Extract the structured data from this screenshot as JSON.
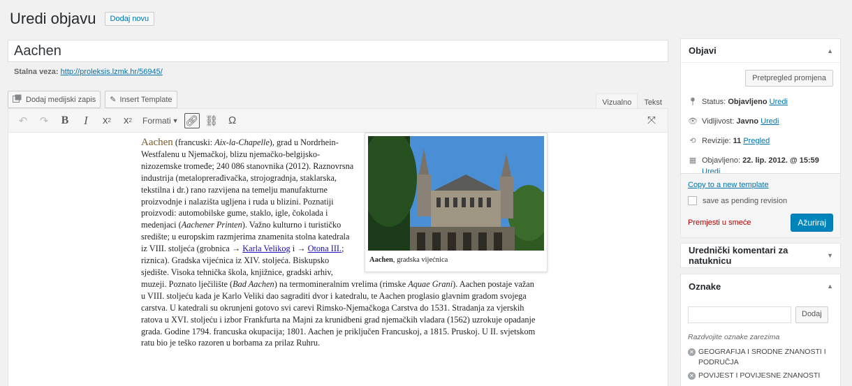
{
  "header": {
    "title": "Uredi objavu",
    "add_new": "Dodaj novu"
  },
  "post": {
    "title": "Aachen",
    "permalink_label": "Stalna veza:",
    "permalink_url": "http://proleksis.lzmk.hr/56945/"
  },
  "media": {
    "add_media": "Dodaj medijski zapis",
    "insert_template": "Insert Template"
  },
  "editor_tabs": {
    "visual": "Vizualno",
    "text": "Tekst"
  },
  "toolbar": {
    "format": "Formati"
  },
  "article": {
    "head": "Aachen",
    "p1": " (francuski: ",
    "p1_italic": "Aix-la-Chapelle",
    "p2": "), grad u Nordrhein-Westfalenu u Njemačkoj, blizu njemačko-belgijsko-nizozemske tromeđe; 240 086 stanovnika (2012). Raznovrsna industrija (metaloprerađivačka, strojogradnja, staklarska, tekstilna i dr.) rano razvijena na temelju manufakturne proizvodnje i nalazišta ugljena i ruda u blizini. Poznatiji proizvodi: automobilske gume, staklo, igle, čokolada i medenjaci (",
    "p2_italic": "Aachener Printen",
    "p3": "). Važno kulturno i turističko središte; u europskim razmjerima znamenita stolna katedrala iz VIII. stoljeća (grobnica → ",
    "link1": "Karla Velikog",
    "p4": " i → ",
    "link2": "Otona III.",
    "p5": "; riznica). Gradska vijećnica iz XIV. stoljeća. Biskupsko sjedište. Visoka tehnička škola, knjižnice, gradski arhiv, muzeji. Poznato lječilište (",
    "p5_italic": "Bad Aachen",
    "p6": ") na termomineralnim vrelima (rimske ",
    "p6_italic": "Aquae Grani",
    "p7": "). Aachen postaje važan u VIII. stoljeću kada je Karlo Veliki dao sagraditi dvor i katedralu, te Aachen proglasio glavnim gradom svojega carstva. U katedrali su okrunjeni gotovo svi carevi Rimsko-Njemačkoga Carstva do 1531. Stradanja za vjerskih ratova u XVI. stoljeću i izbor Frankfurta na Majni za krunidbeni grad njemačkih vladara (1562) uzrokuje opadanje grada. Godine 1794. francuska okupacija; 1801. Aachen je priključen Francuskoj, a 1815. Pruskoj. U II. svjetskom ratu bio je teško razoren u borbama za prilaz Ruhru.",
    "caption_bold": "Aachen",
    "caption_rest": ", gradska vijećnica"
  },
  "publish": {
    "title": "Objavi",
    "preview": "Pretpregled promjena",
    "status_label": "Status:",
    "status_value": "Objavljeno",
    "edit": "Uredi",
    "visibility_label": "Vidljivost:",
    "visibility_value": "Javno",
    "revisions_label": "Revizije:",
    "revisions_value": "11",
    "revisions_link": "Pregled",
    "published_label": "Objavljeno:",
    "published_value": "22. lip. 2012. @ 15:59",
    "copy_template": "Copy to a new template",
    "pending": "save as pending revision",
    "trash": "Premjesti u smeće",
    "update": "Ažuriraj"
  },
  "editor_comments": {
    "title": "Urednički komentari za natuknicu"
  },
  "tags": {
    "title": "Oznake",
    "add": "Dodaj",
    "hint": "Razdvojite oznake zarezima",
    "items": [
      "GEOGRAFIJA I SRODNE ZNANOSTI I PODRUČJA",
      "POVIJEST I POVIJESNE ZNANOSTI"
    ]
  }
}
